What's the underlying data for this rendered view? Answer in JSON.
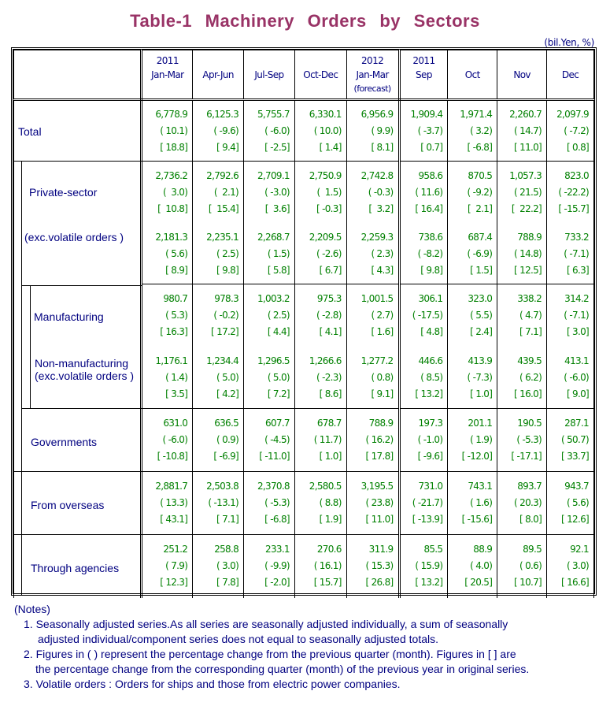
{
  "title": "Table-1   Machinery   Orders   by   Sectors",
  "unit": "(bil.Yen, %)",
  "columns": [
    {
      "line1": "2011",
      "line2": "Jan-Mar",
      "line3": ""
    },
    {
      "line1": "",
      "line2": "Apr-Jun",
      "line3": ""
    },
    {
      "line1": "",
      "line2": "Jul-Sep",
      "line3": ""
    },
    {
      "line1": "",
      "line2": "Oct-Dec",
      "line3": ""
    },
    {
      "line1": "2012",
      "line2": "Jan-Mar",
      "line3": "(forecast)"
    },
    {
      "line1": "2011",
      "line2": "Sep",
      "line3": ""
    },
    {
      "line1": "",
      "line2": "Oct",
      "line3": ""
    },
    {
      "line1": "",
      "line2": "Nov",
      "line3": ""
    },
    {
      "line1": "",
      "line2": "Dec",
      "line3": ""
    }
  ],
  "rows": [
    {
      "label": "Total",
      "label2": "",
      "values": [
        "6,778.9",
        "6,125.3",
        "5,755.7",
        "6,330.1",
        "6,956.9",
        "1,909.4",
        "1,971.4",
        "2,260.7",
        "2,097.9"
      ],
      "qoq": [
        "( 10.1)",
        "( -9.6)",
        "( -6.0)",
        "( 10.0)",
        "( 9.9)",
        "( -3.7)",
        "( 3.2)",
        "( 14.7)",
        "( -7.2)"
      ],
      "yoy": [
        "[ 18.8]",
        "[ 9.4]",
        "[ -2.5]",
        "[ 1.4]",
        "[ 8.1]",
        "[ 0.7]",
        "[ -6.8]",
        "[ 11.0]",
        "[ 0.8]"
      ]
    },
    {
      "label": "Private-sector",
      "label2": "",
      "values": [
        "2,736.2",
        "2,792.6",
        "2,709.1",
        "2,750.9",
        "2,742.8",
        "958.6",
        "870.5",
        "1,057.3",
        "823.0"
      ],
      "qoq": [
        "(  3.0)",
        "(  2.1)",
        "( -3.0)",
        "(  1.5)",
        "( -0.3)",
        "( 11.6)",
        "( -9.2)",
        "( 21.5)",
        "( -22.2)"
      ],
      "yoy": [
        "[  10.8]",
        "[  15.4]",
        "[  3.6]",
        "[ -0.3]",
        "[  3.2]",
        "[ 16.4]",
        "[  2.1]",
        "[  22.2]",
        "[ -15.7]"
      ]
    },
    {
      "label": "(exc.volatile orders )",
      "label2": "",
      "values": [
        "2,181.3",
        "2,235.1",
        "2,268.7",
        "2,209.5",
        "2,259.3",
        "738.6",
        "687.4",
        "788.9",
        "733.2"
      ],
      "qoq": [
        "( 5.6)",
        "( 2.5)",
        "( 1.5)",
        "( -2.6)",
        "( 2.3)",
        "( -8.2)",
        "( -6.9)",
        "( 14.8)",
        "( -7.1)"
      ],
      "yoy": [
        "[ 8.9]",
        "[ 9.8]",
        "[ 5.8]",
        "[ 6.7]",
        "[ 4.3]",
        "[ 9.8]",
        "[ 1.5]",
        "[ 12.5]",
        "[ 6.3]"
      ]
    },
    {
      "label": "Manufacturing",
      "label2": "",
      "values": [
        "980.7",
        "978.3",
        "1,003.2",
        "975.3",
        "1,001.5",
        "306.1",
        "323.0",
        "338.2",
        "314.2"
      ],
      "qoq": [
        "( 5.3)",
        "( -0.2)",
        "( 2.5)",
        "( -2.8)",
        "( 2.7)",
        "( -17.5)",
        "( 5.5)",
        "( 4.7)",
        "( -7.1)"
      ],
      "yoy": [
        "[ 16.3]",
        "[ 17.2]",
        "[ 4.4]",
        "[ 4.1]",
        "[ 1.6]",
        "[ 4.8]",
        "[ 2.4]",
        "[ 7.1]",
        "[ 3.0]"
      ]
    },
    {
      "label": "Non-manufacturing",
      "label2": "(exc.volatile orders )",
      "values": [
        "1,176.1",
        "1,234.4",
        "1,296.5",
        "1,266.6",
        "1,277.2",
        "446.6",
        "413.9",
        "439.5",
        "413.1"
      ],
      "qoq": [
        "( 1.4)",
        "( 5.0)",
        "( 5.0)",
        "( -2.3)",
        "( 0.8)",
        "( 8.5)",
        "( -7.3)",
        "( 6.2)",
        "( -6.0)"
      ],
      "yoy": [
        "[ 3.5]",
        "[ 4.2]",
        "[ 7.2]",
        "[ 8.6]",
        "[ 9.1]",
        "[ 13.2]",
        "[ 1.0]",
        "[ 16.0]",
        "[ 9.0]"
      ]
    },
    {
      "label": "Governments",
      "label2": "",
      "values": [
        "631.0",
        "636.5",
        "607.7",
        "678.7",
        "788.9",
        "197.3",
        "201.1",
        "190.5",
        "287.1"
      ],
      "qoq": [
        "( -6.0)",
        "( 0.9)",
        "( -4.5)",
        "( 11.7)",
        "( 16.2)",
        "( -1.0)",
        "( 1.9)",
        "( -5.3)",
        "( 50.7)"
      ],
      "yoy": [
        "[ -10.8]",
        "[ -6.9]",
        "[ -11.0]",
        "[ 1.0]",
        "[ 17.8]",
        "[ -9.6]",
        "[ -12.0]",
        "[ -17.1]",
        "[ 33.7]"
      ]
    },
    {
      "label": "From overseas",
      "label2": "",
      "values": [
        "2,881.7",
        "2,503.8",
        "2,370.8",
        "2,580.5",
        "3,195.5",
        "731.0",
        "743.1",
        "893.7",
        "943.7"
      ],
      "qoq": [
        "( 13.3)",
        "( -13.1)",
        "( -5.3)",
        "( 8.8)",
        "( 23.8)",
        "( -21.7)",
        "( 1.6)",
        "( 20.3)",
        "( 5.6)"
      ],
      "yoy": [
        "[ 43.1]",
        "[ 7.1]",
        "[ -6.8]",
        "[ 1.9]",
        "[ 11.0]",
        "[ -13.9]",
        "[ -15.6]",
        "[ 8.0]",
        "[ 12.6]"
      ]
    },
    {
      "label": "Through agencies",
      "label2": "",
      "values": [
        "251.2",
        "258.8",
        "233.1",
        "270.6",
        "311.9",
        "85.5",
        "88.9",
        "89.5",
        "92.1"
      ],
      "qoq": [
        "( 7.9)",
        "( 3.0)",
        "( -9.9)",
        "( 16.1)",
        "( 15.3)",
        "( 15.9)",
        "( 4.0)",
        "( 0.6)",
        "( 3.0)"
      ],
      "yoy": [
        "[ 12.3]",
        "[ 7.8]",
        "[ -2.0]",
        "[ 15.7]",
        "[ 26.8]",
        "[ 13.2]",
        "[ 20.5]",
        "[ 10.7]",
        "[ 16.6]"
      ]
    }
  ],
  "notes": {
    "heading": "(Notes)",
    "n1a": "1. Seasonally adjusted series.As all series are seasonally adjusted individually, a sum of seasonally",
    "n1b": "adjusted individual/component series does not equal to seasonally adjusted totals.",
    "n2a": "2. Figures in ( ) represent the percentage change from the previous quarter (month). Figures in [ ] are",
    "n2b": "the percentage change from the corresponding quarter (month) of the previous year in original series.",
    "n3": "3. Volatile orders : Orders for ships and those from electric power companies."
  }
}
